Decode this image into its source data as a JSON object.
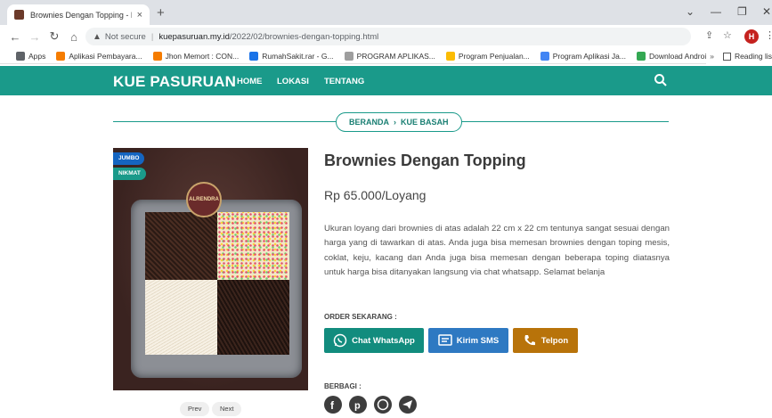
{
  "browser": {
    "tab_title": "Brownies Dengan Topping - Kue",
    "tab_close": "×",
    "new_tab": "+",
    "security": "Not secure",
    "url_host": "kuepasuruan.my.id",
    "url_path": "/2022/02/brownies-dengan-topping.html",
    "profile_initial": "H",
    "bookmarks": [
      {
        "label": "Apps",
        "color": "#5f6368"
      },
      {
        "label": "Aplikasi Pembayara...",
        "color": "#f57c00"
      },
      {
        "label": "Jhon Memort : CON...",
        "color": "#f57c00"
      },
      {
        "label": "RumahSakit.rar - G...",
        "color": "#1a73e8"
      },
      {
        "label": "PROGRAM APLIKAS...",
        "color": "#9e9e9e"
      },
      {
        "label": "Program Penjualan...",
        "color": "#fbbc04"
      },
      {
        "label": "Program Aplikasi Ja...",
        "color": "#4285f4"
      },
      {
        "label": "Download Android...",
        "color": "#34a853"
      }
    ],
    "bookmarks_more": "»",
    "reading_list": "Reading lis"
  },
  "site": {
    "logo": "KUE PASURUAN",
    "menu": [
      "HOME",
      "LOKASI",
      "TENTANG"
    ],
    "breadcrumb": {
      "home": "BERANDA",
      "sep": "›",
      "category": "KUE BASAH"
    }
  },
  "product": {
    "badges": [
      "JUMBO",
      "NIKMAT"
    ],
    "seal_text": "ALRENDRA",
    "title": "Brownies Dengan Topping",
    "price": "Rp 65.000/Loyang",
    "description": "Ukuran loyang dari brownies di atas adalah 22 cm x 22 cm tentunya sangat sesuai dengan harga yang di tawarkan di atas. Anda juga bisa memesan brownies dengan toping mesis, coklat, keju, kacang dan Anda juga bisa memesan dengan beberapa toping diatasnya untuk harga bisa ditanyakan langsung via chat whatsapp. Selamat belanja",
    "prev": "Prev",
    "next": "Next"
  },
  "order": {
    "label": "ORDER SEKARANG :",
    "whatsapp": "Chat WhatsApp",
    "sms": "Kirim SMS",
    "call": "Telpon"
  },
  "share": {
    "label": "BERBAGI :",
    "icons": [
      "facebook-icon",
      "pinterest-icon",
      "whatsapp-icon",
      "telegram-icon"
    ]
  },
  "colors": {
    "brand": "#1a9a8a",
    "whatsapp": "#128c7e",
    "sms": "#2e79c2",
    "call": "#b8730a",
    "badge_jumbo": "#1565c0",
    "badge_nikmat": "#1a9a8a"
  }
}
